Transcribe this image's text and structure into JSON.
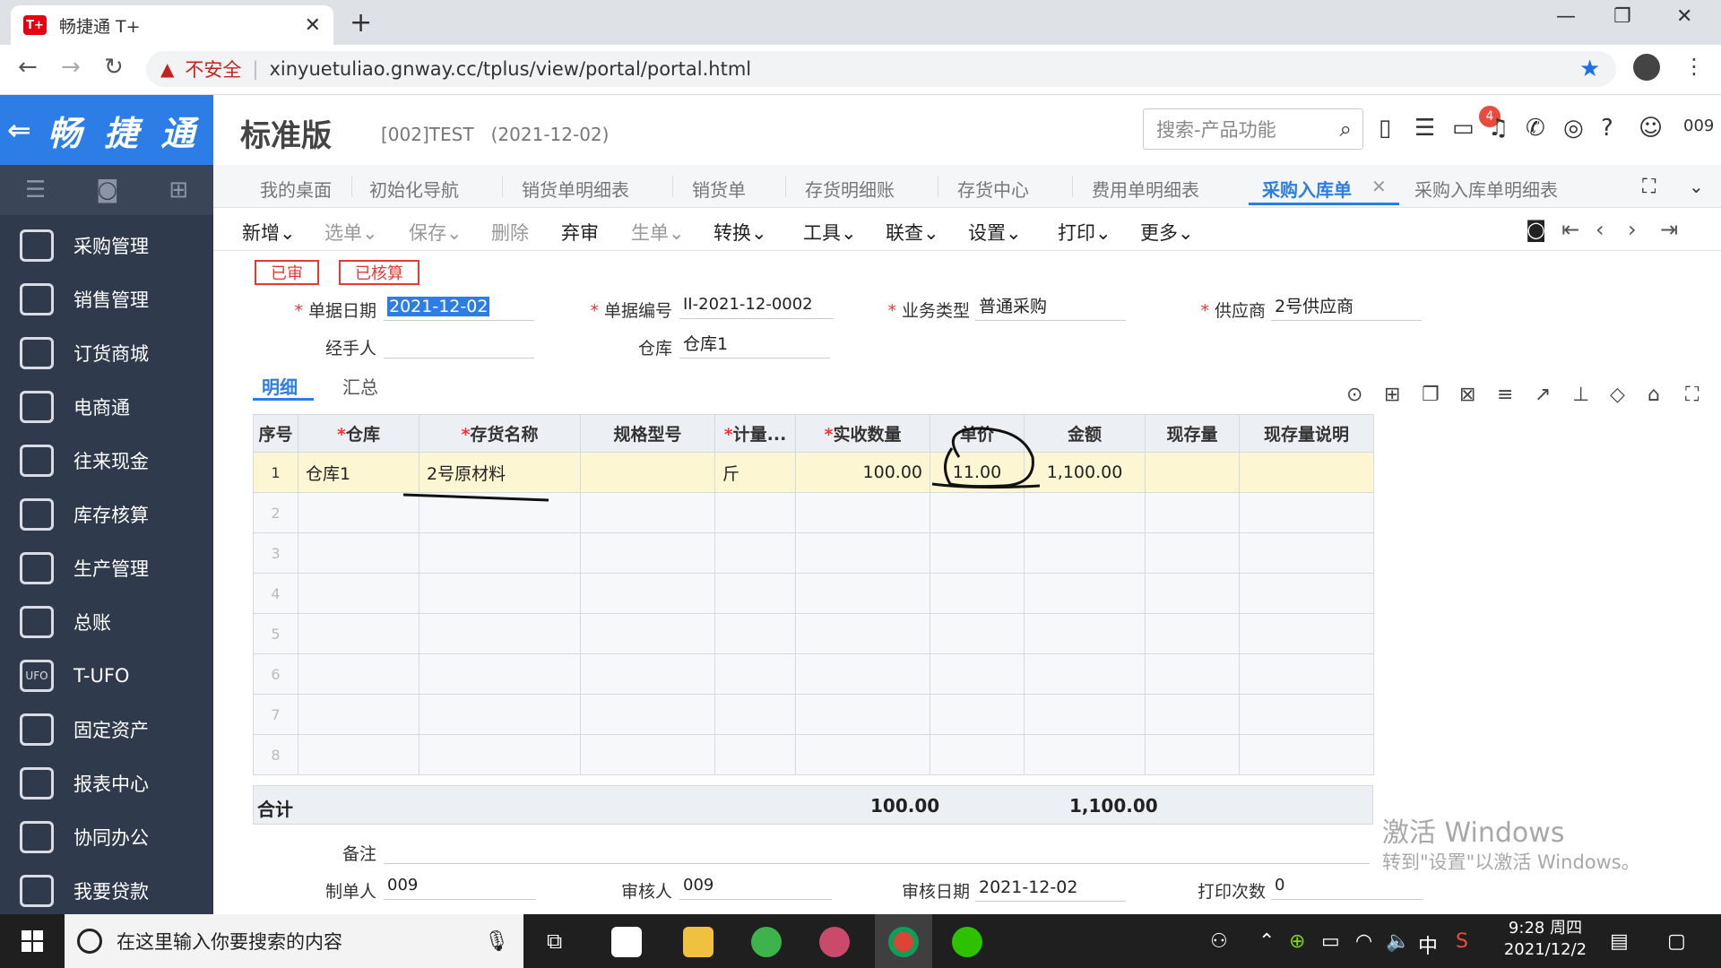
{
  "browser": {
    "tab_title": "畅捷通 T+",
    "favicon_text": "T+",
    "not_secure": "不安全",
    "url": "xinyuetuliao.gnway.cc/tplus/view/portal/portal.html"
  },
  "app": {
    "logo": "畅 捷 通",
    "edition": "标准版",
    "account": "[002]TEST",
    "login_date": "(2021-12-02)",
    "search_placeholder": "搜索-产品功能",
    "notification_count": "4",
    "user": "009"
  },
  "sidebar": {
    "items": [
      {
        "label": "采购管理",
        "icon": "purchase-icon"
      },
      {
        "label": "销售管理",
        "icon": "sales-icon"
      },
      {
        "label": "订货商城",
        "icon": "mall-icon"
      },
      {
        "label": "电商通",
        "icon": "ecommerce-icon"
      },
      {
        "label": "往来现金",
        "icon": "cash-icon"
      },
      {
        "label": "库存核算",
        "icon": "inventory-icon"
      },
      {
        "label": "生产管理",
        "icon": "production-icon"
      },
      {
        "label": "总账",
        "icon": "ledger-icon"
      },
      {
        "label": "T-UFO",
        "icon": "ufo-icon"
      },
      {
        "label": "固定资产",
        "icon": "asset-icon"
      },
      {
        "label": "报表中心",
        "icon": "report-icon"
      },
      {
        "label": "协同办公",
        "icon": "office-icon"
      },
      {
        "label": "我要贷款",
        "icon": "loan-icon"
      }
    ]
  },
  "tabs": [
    "我的桌面",
    "初始化导航",
    "销货单明细表",
    "销货单",
    "存货明细账",
    "存货中心",
    "费用单明细表",
    "采购入库单",
    "采购入库单明细表"
  ],
  "toolbar": {
    "new": "新增",
    "select": "选单",
    "save": "保存",
    "delete": "删除",
    "unaudit": "弃审",
    "generate": "生单",
    "convert": "转换",
    "tools": "工具",
    "linked": "联查",
    "settings": "设置",
    "print": "打印",
    "more": "更多"
  },
  "status": {
    "audited": "已审",
    "accounted": "已核算"
  },
  "form": {
    "date_label": "单据日期",
    "date": "2021-12-02",
    "number_label": "单据编号",
    "number": "II-2021-12-0002",
    "biztype_label": "业务类型",
    "biztype": "普通采购",
    "supplier_label": "供应商",
    "supplier": "2号供应商",
    "handler_label": "经手人",
    "handler": "",
    "warehouse_label": "仓库",
    "warehouse": "仓库1"
  },
  "subtabs": {
    "detail": "明细",
    "summary": "汇总"
  },
  "grid": {
    "headers": [
      "序号",
      "仓库",
      "存货名称",
      "规格型号",
      "计量...",
      "实收数量",
      "单价",
      "金额",
      "现存量",
      "现存量说明"
    ],
    "rows": [
      {
        "no": "1",
        "warehouse": "仓库1",
        "item": "2号原材料",
        "spec": "",
        "unit": "斤",
        "qty": "100.00",
        "price": "11.00",
        "amount": "1,100.00",
        "stock": "",
        "stock_note": ""
      }
    ],
    "empty_rows": [
      "2",
      "3",
      "4",
      "5",
      "6",
      "7",
      "8"
    ],
    "total_label": "合计",
    "total_qty": "100.00",
    "total_amount": "1,100.00"
  },
  "footer": {
    "remark_label": "备注",
    "remark": "",
    "maker_label": "制单人",
    "maker": "009",
    "auditor_label": "审核人",
    "auditor": "009",
    "audit_date_label": "审核日期",
    "audit_date": "2021-12-02",
    "print_count_label": "打印次数",
    "print_count": "0"
  },
  "watermark": {
    "line1": "激活 Windows",
    "line2": "转到\"设置\"以激活 Windows。"
  },
  "taskbar": {
    "search_placeholder": "在这里输入你要搜索的内容",
    "ime": "中",
    "time": "9:28 周四",
    "date": "2021/12/2"
  }
}
